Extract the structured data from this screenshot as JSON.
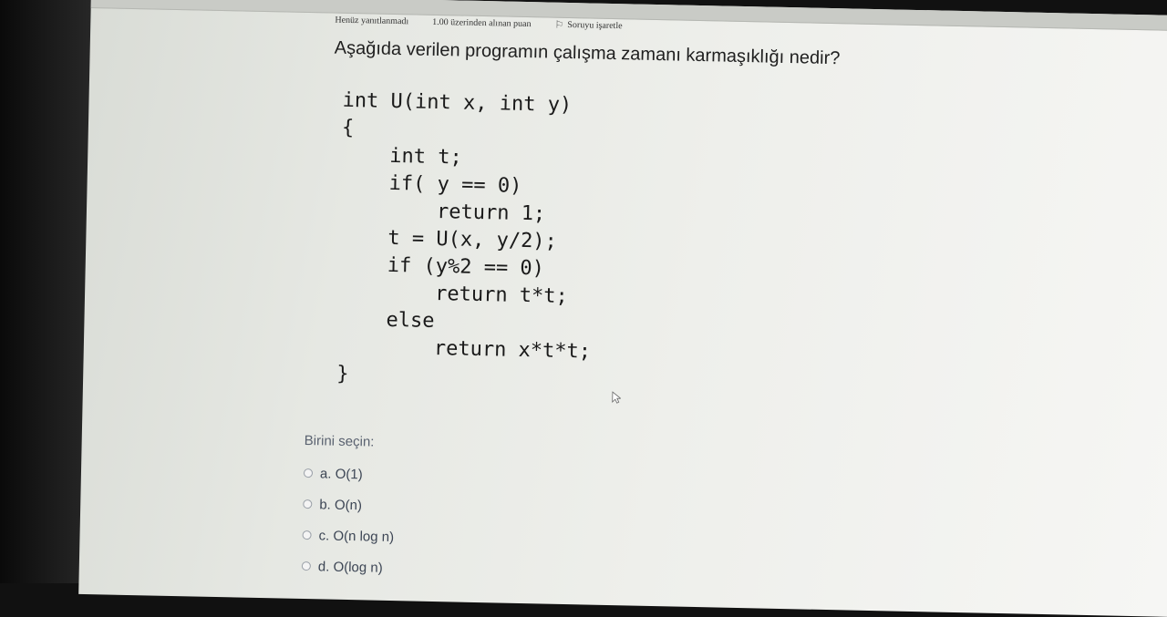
{
  "question_meta": {
    "status": "Henüz yanıtlanmadı",
    "points": "1.00 üzerinden alınan puan",
    "flag_label": "Soruyu işaretle"
  },
  "question": {
    "text": "Aşağıda verilen programın çalışma zamanı karmaşıklığı nedir?"
  },
  "code_lines": [
    "int U(int x, int y)",
    "{",
    "    int t;",
    "    if( y == 0)",
    "        return 1;",
    "    t = U(x, y/2);",
    "    if (y%2 == 0)",
    "        return t*t;",
    "    else",
    "        return x*t*t;",
    "}"
  ],
  "answers": {
    "prompt": "Birini seçin:",
    "options": [
      {
        "label": "a. O(1)"
      },
      {
        "label": "b. O(n)"
      },
      {
        "label": "c. O(n log n)"
      },
      {
        "label": "d. O(log n)"
      }
    ]
  },
  "icons": {
    "flag": "flag-icon",
    "radio": "radio-icon",
    "cursor": "mouse-pointer-icon"
  }
}
